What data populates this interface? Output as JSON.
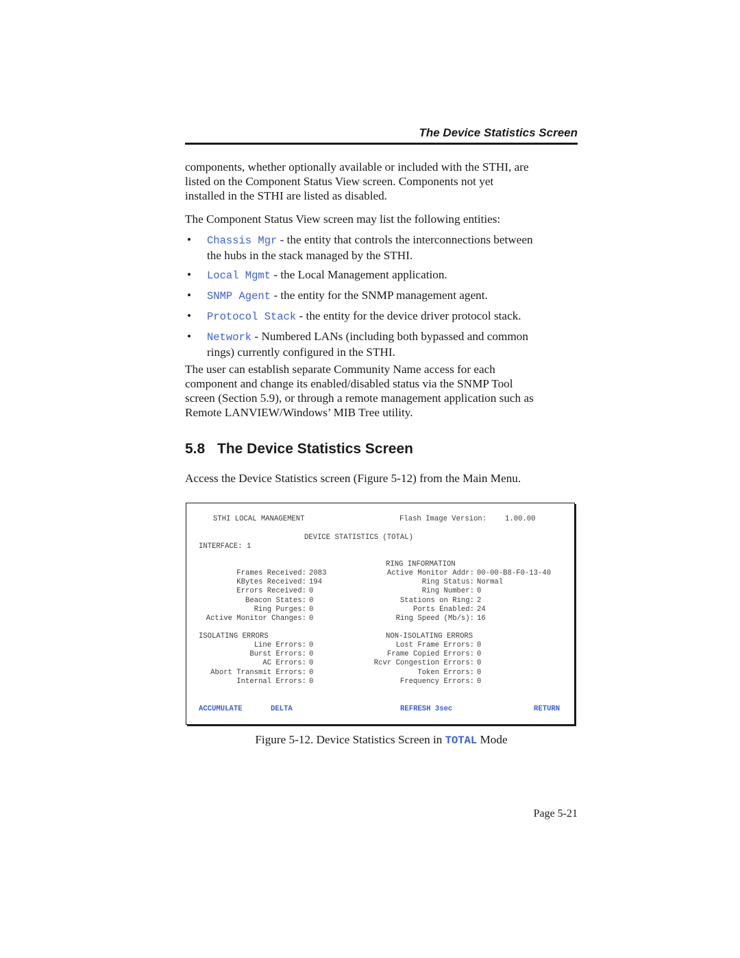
{
  "header": {
    "running_title": "The Device Statistics Screen"
  },
  "intro_paragraph": "components, whether optionally available or included with the STHI, are listed on the Component Status View screen. Components not yet installed in the STHI are listed as disabled.",
  "intro_lines": [
    "components, whether optionally available or included with the STHI, are",
    "listed on the Component Status View screen. Components not yet",
    "installed in the STHI are listed as disabled."
  ],
  "entities_lead": "The Component Status View screen may list the following entities:",
  "entities": [
    {
      "name": "Chassis Mgr",
      "desc_lines": [
        " - the entity that controls the interconnections between",
        "the hubs in the stack managed by the STHI."
      ]
    },
    {
      "name": "Local Mgmt",
      "desc_lines": [
        " - the Local Management application."
      ]
    },
    {
      "name": "SNMP Agent",
      "desc_lines": [
        " - the entity for the SNMP management agent."
      ]
    },
    {
      "name": "Protocol Stack",
      "desc_lines": [
        " - the entity for the device driver protocol stack."
      ]
    },
    {
      "name": "Network",
      "desc_lines": [
        " - Numbered LANs (including both bypassed and common",
        "rings) currently configured in the STHI."
      ]
    }
  ],
  "community_lines": [
    "The user can establish separate Community Name access for each",
    "component and change its enabled/disabled status via the SNMP Tool",
    "screen (Section 5.9), or through a remote management application such as",
    "Remote LANVIEW/Windows’ MIB Tree utility."
  ],
  "section": {
    "number": "5.8",
    "title": "The Device Statistics Screen",
    "access_text": "Access the Device Statistics screen (Figure 5-12) from the Main Menu."
  },
  "terminal": {
    "app_title": "STHI LOCAL MANAGEMENT",
    "flash_label": "Flash Image Version:",
    "flash_value": "1.00.00",
    "screen_title": "DEVICE STATISTICS (TOTAL)",
    "interface_label": "INTERFACE:",
    "interface_value": "1",
    "receive_stats": [
      {
        "label": "Frames Received:",
        "value": "2083"
      },
      {
        "label": "KBytes Received:",
        "value": "194"
      },
      {
        "label": "Errors Received:",
        "value": "0"
      },
      {
        "label": "Beacon States:",
        "value": "0"
      },
      {
        "label": "Ring Purges:",
        "value": "0"
      },
      {
        "label": "Active Monitor Changes:",
        "value": "0"
      }
    ],
    "ring_info_heading": "RING INFORMATION",
    "ring_info": [
      {
        "label": "Active Monitor Addr:",
        "value": "00-00-B8-F0-13-40"
      },
      {
        "label": "Ring Status:",
        "value": "Normal"
      },
      {
        "label": "Ring Number:",
        "value": "0"
      },
      {
        "label": "Stations on Ring:",
        "value": "2"
      },
      {
        "label": "Ports Enabled:",
        "value": "24"
      },
      {
        "label": "Ring Speed (Mb/s):",
        "value": "16"
      }
    ],
    "isolating_heading": "ISOLATING ERRORS",
    "isolating_errors": [
      {
        "label": "Line Errors:",
        "value": "0"
      },
      {
        "label": "Burst Errors:",
        "value": "0"
      },
      {
        "label": "AC Errors:",
        "value": "0"
      },
      {
        "label": "Abort Transmit Errors:",
        "value": "0"
      },
      {
        "label": "Internal Errors:",
        "value": "0"
      }
    ],
    "non_isolating_heading": "NON-ISOLATING ERRORS",
    "non_isolating_errors": [
      {
        "label": "Lost Frame Errors:",
        "value": "0"
      },
      {
        "label": "Frame Copied Errors:",
        "value": "0"
      },
      {
        "label": "Rcvr Congestion Errors:",
        "value": "0"
      },
      {
        "label": "Token Errors:",
        "value": "0"
      },
      {
        "label": "Frequency Errors:",
        "value": "0"
      }
    ],
    "commands": {
      "accumulate": "ACCUMULATE",
      "delta": "DELTA",
      "refresh": "REFRESH 3sec",
      "return": "RETURN"
    }
  },
  "caption": {
    "prefix": "Figure 5-12.  Device Statistics Screen in ",
    "mode": "TOTAL",
    "suffix": " Mode"
  },
  "footer": {
    "page_number": "Page 5-21"
  },
  "colors": {
    "code_blue": "#3a5fd6",
    "text": "#1a1a1a"
  }
}
